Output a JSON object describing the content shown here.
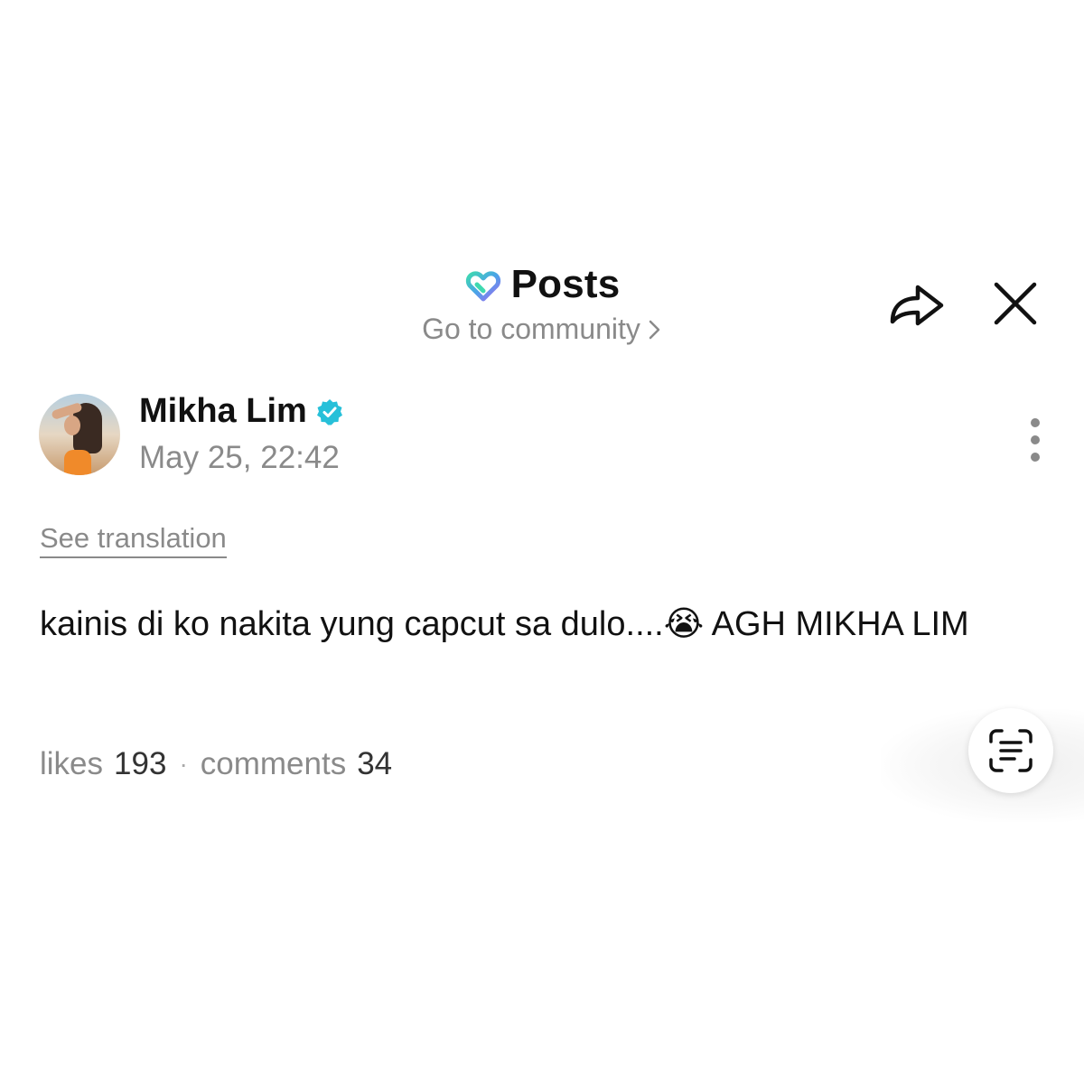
{
  "header": {
    "title": "Posts",
    "community_link": "Go to community",
    "logo_icon": "weverse-heart-logo-icon",
    "share_icon": "share-arrow-icon",
    "close_icon": "close-icon"
  },
  "post": {
    "author": "Mikha Lim",
    "verified": true,
    "timestamp": "May 25, 22:42",
    "see_translation": "See translation",
    "text": "kainis di ko nakita yung capcut sa dulo....",
    "emoji": "😭",
    "text_after_emoji": " AGH MIKHA LIM",
    "likes_label": "likes",
    "likes_count": "193",
    "separator": "·",
    "comments_label": "comments",
    "comments_count": "34"
  },
  "colors": {
    "accent_verified": "#27c0d9",
    "muted_text": "#8a8a8a",
    "primary_text": "#111111"
  }
}
